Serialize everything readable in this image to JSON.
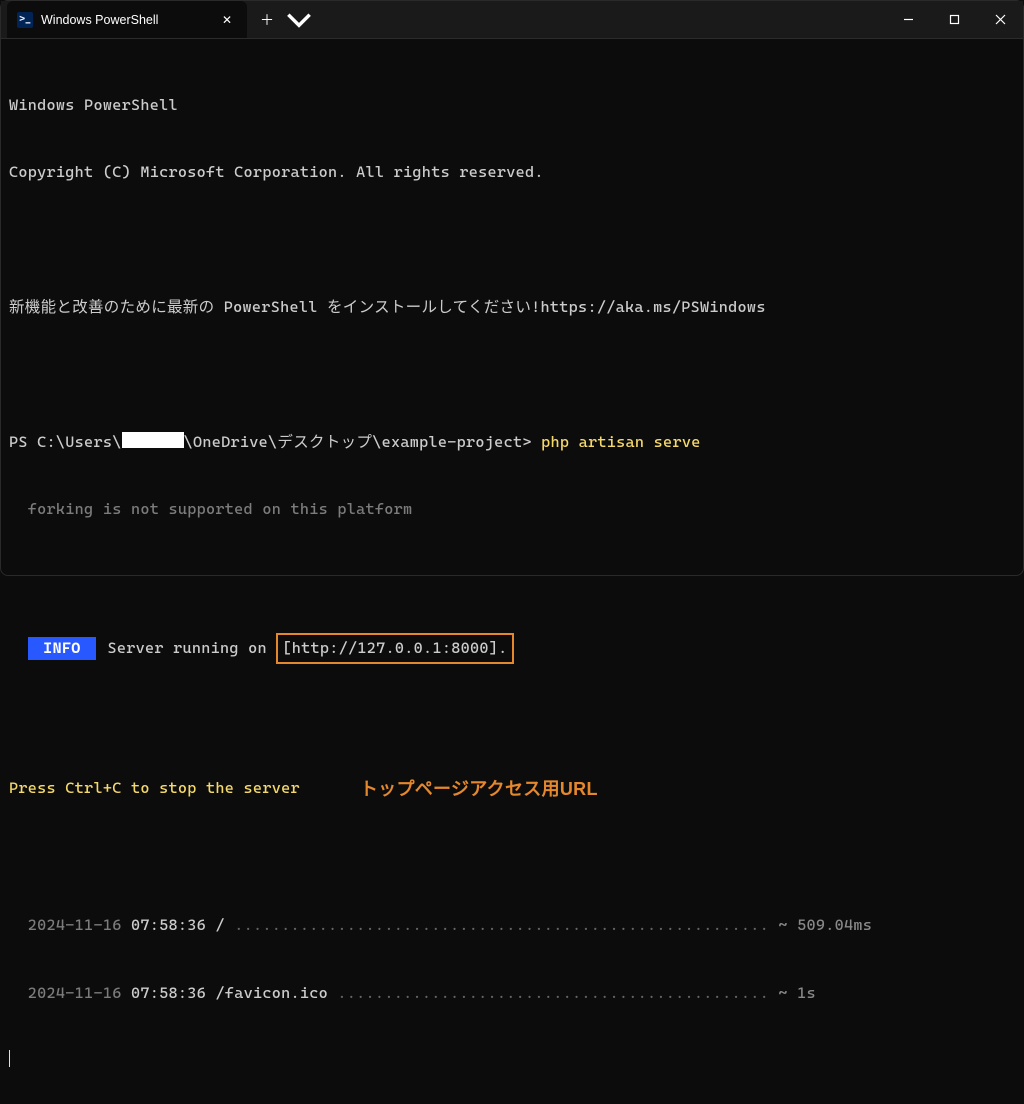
{
  "titleBar": {
    "tabIconText": ">_",
    "tabTitle": "Windows PowerShell"
  },
  "terminal": {
    "header1": "Windows PowerShell",
    "header2": "Copyright (C) Microsoft Corporation. All rights reserved.",
    "msg_jp": "新機能と改善のために最新の PowerShell をインストールしてください!https://aka.ms/PSWindows",
    "prompt_pre": "PS C:\\Users\\",
    "prompt_post": "\\OneDrive\\デスクトップ\\example-project> ",
    "command": "php artisan serve",
    "warn": "  forking is not supported on this platform",
    "info_badge": " INFO ",
    "info_text_pre": " Server running on ",
    "url": "[http://127.0.0.1:8000].",
    "stop_hint": "Press Ctrl+C to stop the server",
    "annotation": "トップページアクセス用URL",
    "log1_date": "  2024-11-16",
    "log1_time": " 07:58:36",
    "log1_path": " / ",
    "log1_dots": ".........................................................",
    "log1_tail": " ~ 509.04ms",
    "log2_date": "  2024-11-16",
    "log2_time": " 07:58:36",
    "log2_path": " /favicon.ico ",
    "log2_dots": "..............................................",
    "log2_tail": " ~ 1s"
  }
}
